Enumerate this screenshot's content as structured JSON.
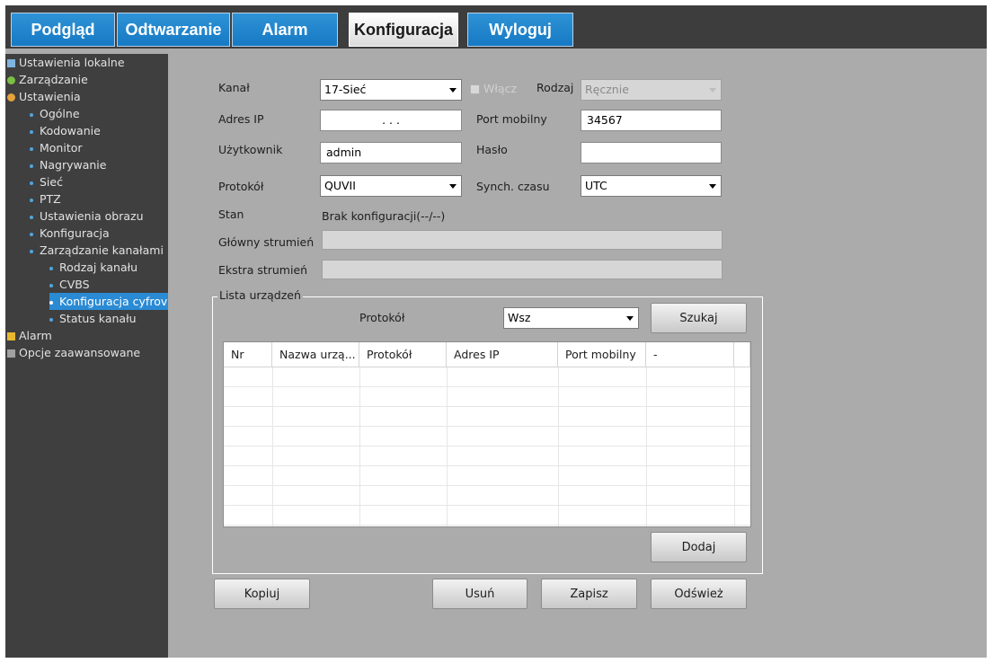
{
  "tabs": [
    "Podgląd",
    "Odtwarzanie",
    "Alarm",
    "Konfiguracja",
    "Wyloguj"
  ],
  "sidebar": {
    "items": [
      "Ustawienia lokalne",
      "Zarządzanie",
      "Ustawienia",
      "Ogólne",
      "Kodowanie",
      "Monitor",
      "Nagrywanie",
      "Sieć",
      "PTZ",
      "Ustawienia obrazu",
      "Konfiguracja",
      "Zarządzanie kanałami",
      "Rodzaj kanału",
      "CVBS",
      "Konfiguracja cyfrov",
      "Status kanału",
      "Alarm",
      "Opcje zaawansowane"
    ],
    "selected": "Konfiguracja cyfrov"
  },
  "form": {
    "kanal_label": "Kanał",
    "kanal_value": "17-Sieć",
    "wlacz_label": "Włącz",
    "rodzaj_label": "Rodzaj",
    "rodzaj_value": "Ręcznie",
    "adres_ip_label": "Adres IP",
    "adres_ip_value": ".      .      .",
    "port_label": "Port mobilny",
    "port_value": "34567",
    "uzytkownik_label": "Użytkownik",
    "uzytkownik_value": "admin",
    "haslo_label": "Hasło",
    "haslo_value": "",
    "protokol_label": "Protokół",
    "protokol_value": "QUVII",
    "synch_label": "Synch. czasu",
    "synch_value": "UTC",
    "stan_label": "Stan",
    "stan_value": "Brak konfiguracji(--/--)",
    "glowny_label": "Główny strumień",
    "glowny_value": "",
    "ekstra_label": "Ekstra strumień",
    "ekstra_value": ""
  },
  "device_list": {
    "title": "Lista urządzeń",
    "protokol_label": "Protokół",
    "protokol_value": "Wsz",
    "search_button": "Szukaj",
    "columns": [
      "Nr",
      "Nazwa urzą...",
      "Protokół",
      "Adres IP",
      "Port mobilny",
      "-"
    ],
    "rows": [],
    "add_button": "Dodaj"
  },
  "bottom_buttons": {
    "kopiuj": "Kopiuj",
    "usun": "Usuń",
    "zapisz": "Zapisz",
    "odswiez": "Odśwież"
  },
  "colors": {
    "tab_blue": "#1e88d0",
    "selected_blue": "#2a8ad4",
    "panel_gray": "#ababab",
    "sidebar_dark": "#3f3f3f"
  }
}
